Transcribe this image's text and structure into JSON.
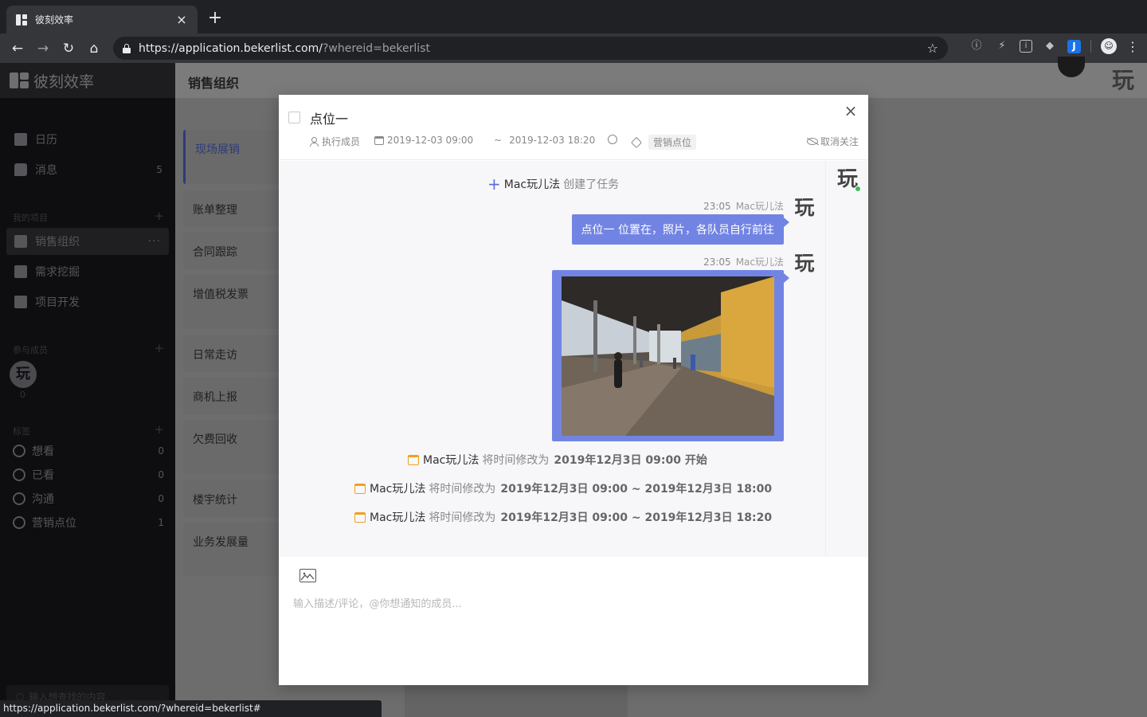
{
  "browser": {
    "tab_title": "彼刻效率",
    "tab_close": "×",
    "new_tab": "+",
    "url_main": "https://application.bekerlist.com/",
    "url_query": "?whereid=bekerlist",
    "status_url": "https://application.bekerlist.com/?whereid=bekerlist#",
    "icons": [
      "back-icon",
      "forward-icon",
      "reload-icon",
      "home-icon",
      "lock-icon",
      "star-icon",
      "info-icon",
      "bolt-icon",
      "extension-icon",
      "shield-icon",
      "j-extension-icon",
      "profile-icon",
      "menu-icon"
    ]
  },
  "sidebar": {
    "logo_text": "彼刻效率",
    "nav": [
      {
        "label": "日历",
        "count": ""
      },
      {
        "label": "消息",
        "count": "5"
      }
    ],
    "projects_label": "我的项目",
    "projects": [
      {
        "label": "销售组织",
        "active": true
      },
      {
        "label": "需求挖掘"
      },
      {
        "label": "项目开发"
      }
    ],
    "more": "···",
    "plus": "+",
    "members_label": "参与成员",
    "member_avatar": "玩",
    "member_count": "0",
    "tags_label": "标签",
    "tags": [
      {
        "label": "想看",
        "count": "0"
      },
      {
        "label": "已看",
        "count": "0"
      },
      {
        "label": "沟通",
        "count": "0"
      },
      {
        "label": "营销点位",
        "count": "1"
      }
    ],
    "search_placeholder": "输入想查找的内容"
  },
  "main": {
    "title": "销售组织",
    "header_avatar": "玩",
    "groups": [
      "现场展销",
      "账单整理",
      "合同跟踪",
      "增值税发票",
      "日常走访",
      "商机上报",
      "欠费回收",
      "楼宇统计",
      "业务发展量"
    ]
  },
  "modal": {
    "title": "点位一",
    "close": "×",
    "assignee": "执行成员",
    "start": "2019-12-03 09:00",
    "tilde": "~",
    "end": "2019-12-03 18:20",
    "tag": "营销点位",
    "unfollow": "取消关注",
    "rail_avatar": "玩",
    "activity": {
      "creator": "Mac玩儿法",
      "created_text": "创建了任务",
      "messages": [
        {
          "time": "23:05",
          "author": "Mac玩儿法",
          "avatar": "玩",
          "text": "点位一 位置在，照片，各队员自行前往"
        },
        {
          "time": "23:05",
          "author": "Mac玩儿法",
          "avatar": "玩",
          "image": "walkway-photo"
        }
      ],
      "time_changes": [
        {
          "author": "Mac玩儿法",
          "verb": "将时间修改为",
          "value": "2019年12月3日 09:00 开始"
        },
        {
          "author": "Mac玩儿法",
          "verb": "将时间修改为",
          "value": "2019年12月3日 09:00 ~ 2019年12月3日 18:00"
        },
        {
          "author": "Mac玩儿法",
          "verb": "将时间修改为",
          "value": "2019年12月3日 09:00 ~ 2019年12月3日 18:20"
        }
      ]
    },
    "comment_placeholder": "输入描述/评论，@你想通知的成员..."
  },
  "colors": {
    "accent": "#7284e3",
    "calendar_icon": "#f0a020",
    "online": "#3dbd55"
  }
}
